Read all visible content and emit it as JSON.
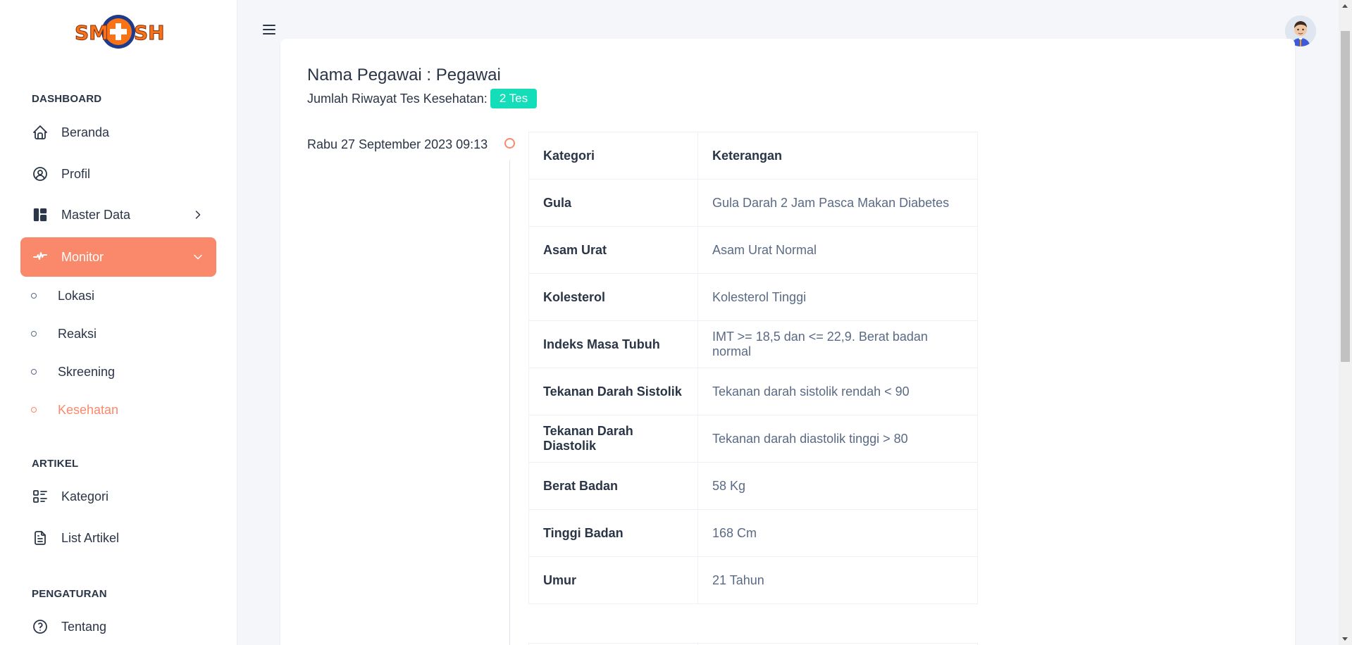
{
  "brand": {
    "logo_text": "SMASH"
  },
  "colors": {
    "accent": "#fa896b",
    "badge": "#13deb9",
    "text": "#2a3547",
    "muted": "#5a6a85"
  },
  "sidebar": {
    "sections": {
      "dashboard": "DASHBOARD",
      "artikel": "ARTIKEL",
      "pengaturan": "PENGATURAN"
    },
    "items": {
      "beranda": {
        "label": "Beranda",
        "icon": "home-icon"
      },
      "profil": {
        "label": "Profil",
        "icon": "user-circle-icon"
      },
      "master_data": {
        "label": "Master Data",
        "icon": "layout-dashboard-icon"
      },
      "monitor": {
        "label": "Monitor",
        "icon": "activity-heartbeat-icon"
      },
      "kategori": {
        "label": "Kategori",
        "icon": "list-details-icon"
      },
      "list_artikel": {
        "label": "List Artikel",
        "icon": "file-text-icon"
      },
      "tentang": {
        "label": "Tentang",
        "icon": "help-circle-icon"
      }
    },
    "monitor_sub": [
      "Lokasi",
      "Reaksi",
      "Skreening",
      "Kesehatan"
    ],
    "active_sub": "Kesehatan"
  },
  "main": {
    "title": "Nama Pegawai : Pegawai",
    "subtitle": "Jumlah Riwayat Tes Kesehatan:",
    "badge": "2 Tes",
    "timeline": [
      {
        "date": "Rabu 27 September 2023 09:13",
        "headers": [
          "Kategori",
          "Keterangan"
        ],
        "rows": [
          [
            "Gula",
            "Gula Darah 2 Jam Pasca Makan Diabetes"
          ],
          [
            "Asam Urat",
            "Asam Urat Normal"
          ],
          [
            "Kolesterol",
            "Kolesterol Tinggi"
          ],
          [
            "Indeks Masa Tubuh",
            "IMT >= 18,5 dan <= 22,9. Berat badan normal"
          ],
          [
            "Tekanan Darah Sistolik",
            "Tekanan darah sistolik rendah < 90"
          ],
          [
            "Tekanan Darah Diastolik",
            "Tekanan darah diastolik tinggi > 80"
          ],
          [
            "Berat Badan",
            "58 Kg"
          ],
          [
            "Tinggi Badan",
            "168 Cm"
          ],
          [
            "Umur",
            "21 Tahun"
          ]
        ]
      }
    ]
  }
}
